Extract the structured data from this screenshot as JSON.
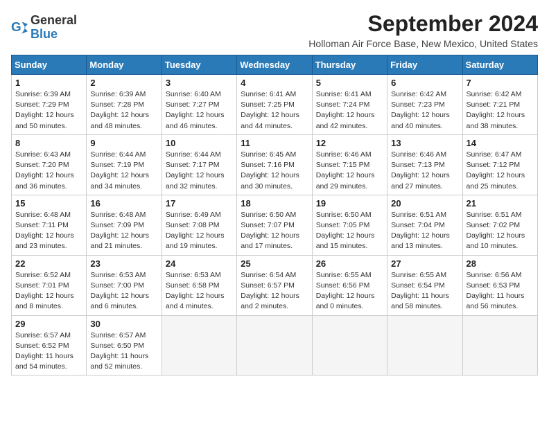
{
  "logo": {
    "general": "General",
    "blue": "Blue"
  },
  "title": "September 2024",
  "subtitle": "Holloman Air Force Base, New Mexico, United States",
  "headers": [
    "Sunday",
    "Monday",
    "Tuesday",
    "Wednesday",
    "Thursday",
    "Friday",
    "Saturday"
  ],
  "weeks": [
    [
      {
        "day": "1",
        "info": "Sunrise: 6:39 AM\nSunset: 7:29 PM\nDaylight: 12 hours\nand 50 minutes."
      },
      {
        "day": "2",
        "info": "Sunrise: 6:39 AM\nSunset: 7:28 PM\nDaylight: 12 hours\nand 48 minutes."
      },
      {
        "day": "3",
        "info": "Sunrise: 6:40 AM\nSunset: 7:27 PM\nDaylight: 12 hours\nand 46 minutes."
      },
      {
        "day": "4",
        "info": "Sunrise: 6:41 AM\nSunset: 7:25 PM\nDaylight: 12 hours\nand 44 minutes."
      },
      {
        "day": "5",
        "info": "Sunrise: 6:41 AM\nSunset: 7:24 PM\nDaylight: 12 hours\nand 42 minutes."
      },
      {
        "day": "6",
        "info": "Sunrise: 6:42 AM\nSunset: 7:23 PM\nDaylight: 12 hours\nand 40 minutes."
      },
      {
        "day": "7",
        "info": "Sunrise: 6:42 AM\nSunset: 7:21 PM\nDaylight: 12 hours\nand 38 minutes."
      }
    ],
    [
      {
        "day": "8",
        "info": "Sunrise: 6:43 AM\nSunset: 7:20 PM\nDaylight: 12 hours\nand 36 minutes."
      },
      {
        "day": "9",
        "info": "Sunrise: 6:44 AM\nSunset: 7:19 PM\nDaylight: 12 hours\nand 34 minutes."
      },
      {
        "day": "10",
        "info": "Sunrise: 6:44 AM\nSunset: 7:17 PM\nDaylight: 12 hours\nand 32 minutes."
      },
      {
        "day": "11",
        "info": "Sunrise: 6:45 AM\nSunset: 7:16 PM\nDaylight: 12 hours\nand 30 minutes."
      },
      {
        "day": "12",
        "info": "Sunrise: 6:46 AM\nSunset: 7:15 PM\nDaylight: 12 hours\nand 29 minutes."
      },
      {
        "day": "13",
        "info": "Sunrise: 6:46 AM\nSunset: 7:13 PM\nDaylight: 12 hours\nand 27 minutes."
      },
      {
        "day": "14",
        "info": "Sunrise: 6:47 AM\nSunset: 7:12 PM\nDaylight: 12 hours\nand 25 minutes."
      }
    ],
    [
      {
        "day": "15",
        "info": "Sunrise: 6:48 AM\nSunset: 7:11 PM\nDaylight: 12 hours\nand 23 minutes."
      },
      {
        "day": "16",
        "info": "Sunrise: 6:48 AM\nSunset: 7:09 PM\nDaylight: 12 hours\nand 21 minutes."
      },
      {
        "day": "17",
        "info": "Sunrise: 6:49 AM\nSunset: 7:08 PM\nDaylight: 12 hours\nand 19 minutes."
      },
      {
        "day": "18",
        "info": "Sunrise: 6:50 AM\nSunset: 7:07 PM\nDaylight: 12 hours\nand 17 minutes."
      },
      {
        "day": "19",
        "info": "Sunrise: 6:50 AM\nSunset: 7:05 PM\nDaylight: 12 hours\nand 15 minutes."
      },
      {
        "day": "20",
        "info": "Sunrise: 6:51 AM\nSunset: 7:04 PM\nDaylight: 12 hours\nand 13 minutes."
      },
      {
        "day": "21",
        "info": "Sunrise: 6:51 AM\nSunset: 7:02 PM\nDaylight: 12 hours\nand 10 minutes."
      }
    ],
    [
      {
        "day": "22",
        "info": "Sunrise: 6:52 AM\nSunset: 7:01 PM\nDaylight: 12 hours\nand 8 minutes."
      },
      {
        "day": "23",
        "info": "Sunrise: 6:53 AM\nSunset: 7:00 PM\nDaylight: 12 hours\nand 6 minutes."
      },
      {
        "day": "24",
        "info": "Sunrise: 6:53 AM\nSunset: 6:58 PM\nDaylight: 12 hours\nand 4 minutes."
      },
      {
        "day": "25",
        "info": "Sunrise: 6:54 AM\nSunset: 6:57 PM\nDaylight: 12 hours\nand 2 minutes."
      },
      {
        "day": "26",
        "info": "Sunrise: 6:55 AM\nSunset: 6:56 PM\nDaylight: 12 hours\nand 0 minutes."
      },
      {
        "day": "27",
        "info": "Sunrise: 6:55 AM\nSunset: 6:54 PM\nDaylight: 11 hours\nand 58 minutes."
      },
      {
        "day": "28",
        "info": "Sunrise: 6:56 AM\nSunset: 6:53 PM\nDaylight: 11 hours\nand 56 minutes."
      }
    ],
    [
      {
        "day": "29",
        "info": "Sunrise: 6:57 AM\nSunset: 6:52 PM\nDaylight: 11 hours\nand 54 minutes."
      },
      {
        "day": "30",
        "info": "Sunrise: 6:57 AM\nSunset: 6:50 PM\nDaylight: 11 hours\nand 52 minutes."
      },
      {
        "day": "",
        "info": ""
      },
      {
        "day": "",
        "info": ""
      },
      {
        "day": "",
        "info": ""
      },
      {
        "day": "",
        "info": ""
      },
      {
        "day": "",
        "info": ""
      }
    ]
  ]
}
